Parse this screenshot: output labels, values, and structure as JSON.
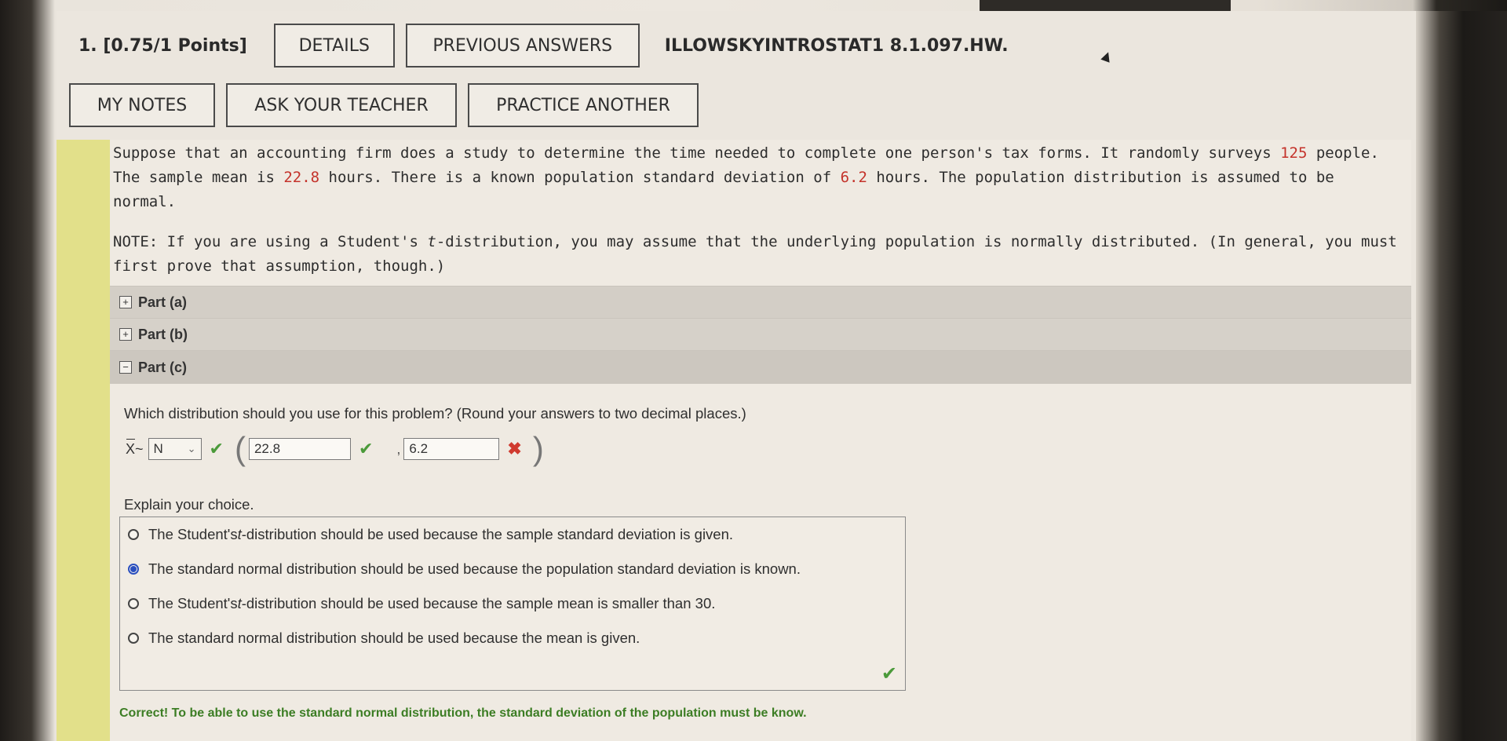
{
  "header": {
    "question_number": "1. [0.75/1 Points]",
    "details_label": "DETAILS",
    "previous_answers_label": "PREVIOUS ANSWERS",
    "assignment_id": "ILLOWSKYINTROSTAT1 8.1.097.HW."
  },
  "toolbar": {
    "my_notes_label": "MY NOTES",
    "ask_teacher_label": "ASK YOUR TEACHER",
    "practice_another_label": "PRACTICE ANOTHER"
  },
  "problem": {
    "text_1": "Suppose that an accounting firm does a study to determine the time needed to complete one person's tax forms. It randomly surveys ",
    "n": "125",
    "text_2": " people. The sample mean is ",
    "mean": "22.8",
    "text_3": " hours. There is a known population standard deviation of ",
    "sd": "6.2",
    "text_4": " hours. The population distribution is assumed to be normal.",
    "note_1": "NOTE: If you are using a Student's ",
    "note_t": "t",
    "note_2": "-distribution, you may assume that the underlying population is normally distributed. (In general, you must first prove that assumption, though.)"
  },
  "parts": [
    {
      "label": "Part (a)",
      "toggle": "+"
    },
    {
      "label": "Part (b)",
      "toggle": "+"
    },
    {
      "label": "Part (c)",
      "toggle": "−"
    }
  ],
  "part_c": {
    "question": "Which distribution should you use for this problem? (Round your answers to two decimal places.)",
    "xbar_symbol": "X",
    "tilde": "~",
    "distribution_selected": "N",
    "mean_value": "22.8",
    "sd_value": "6.2",
    "explain_label": "Explain your choice.",
    "choices": [
      {
        "pre": "The Student's ",
        "t": "t",
        "post": "-distribution should be used because the sample standard deviation is given.",
        "selected": false
      },
      {
        "pre": "The standard normal distribution should be used because the population standard deviation is known.",
        "t": "",
        "post": "",
        "selected": true
      },
      {
        "pre": "The Student's ",
        "t": "t",
        "post": "-distribution should be used because the sample mean is smaller than 30.",
        "selected": false
      },
      {
        "pre": "The standard normal distribution should be used because the mean is given.",
        "t": "",
        "post": "",
        "selected": false
      }
    ],
    "feedback": "Correct! To be able to use the standard normal distribution, the standard deviation of the population must be know."
  },
  "icons": {
    "check": "check-icon",
    "cross": "cross-icon",
    "chevron": "chevron-down-icon"
  },
  "colors": {
    "red_highlight": "#c4332b",
    "correct_green": "#4b9a3a",
    "feedback_green": "#3c7d24",
    "selected_radio": "#2a4fbf",
    "side_bar_yellow": "#e2e08a"
  }
}
